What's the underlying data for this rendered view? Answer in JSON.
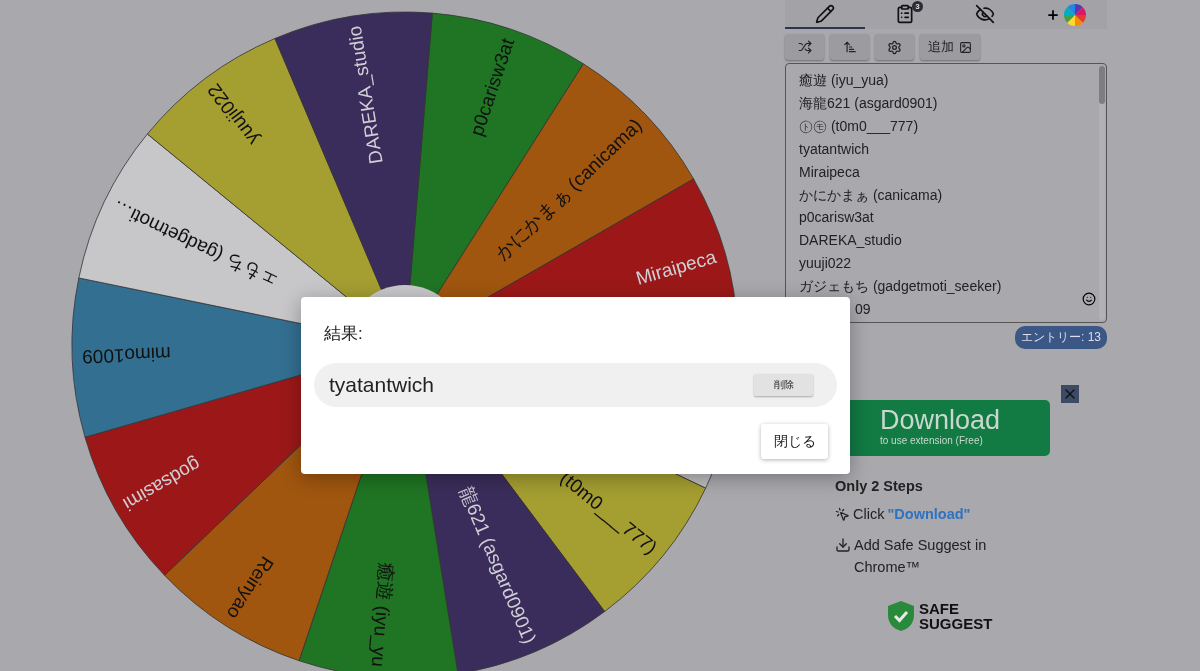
{
  "wheel": {
    "segments": [
      {
        "label": "p0carisw3at",
        "color": "#1f7523"
      },
      {
        "label": "かにかまぁ (canicama)",
        "color": "#a0560f"
      },
      {
        "label": "Miraipeca",
        "color": "#9c1818"
      },
      {
        "kind": "covered"
      },
      {
        "label": "(t0m0___777)",
        "color": "#a59e31"
      },
      {
        "label": "龍621 (asgard0901)",
        "color": "#3b2d5b"
      },
      {
        "label": "癒遊 (iyu_yu",
        "color": "#1f7523"
      },
      {
        "label": "Reinyao",
        "color": "#a0560f"
      },
      {
        "label": "godsasimi",
        "color": "#9c1818"
      },
      {
        "label": "mimo1009",
        "color": "#336f91"
      },
      {
        "label": "ェもち (gadgetmoti…",
        "color": "#c7c7c9"
      },
      {
        "label": "yuuji022",
        "color": "#a59e31"
      },
      {
        "label": "DAREKA_studio",
        "color": "#3b2d5b"
      }
    ]
  },
  "tabs": [
    {
      "selected": true
    },
    {
      "selected": false,
      "badge": "3"
    },
    {
      "selected": false
    }
  ],
  "toolbar": {
    "add_label": "追加"
  },
  "entries": {
    "items": [
      "癒遊 (iyu_yua)",
      "海龍621 (asgard0901)",
      "㋣㋲ (t0m0___777)",
      "tyatantwich",
      "Miraipeca",
      "かにかまぁ (canicama)",
      "p0carisw3at",
      "DAREKA_studio",
      "yuuji022",
      "ガジェもち (gadgetmoti_seeker)",
      "09"
    ],
    "count": "エントリー: 13"
  },
  "ad": {
    "button_title": "Download",
    "button_subtitle": "to use extension (Free)",
    "heading": "Only 2 Steps",
    "step_1_text": "Click",
    "step_1_link": "\"Download\"",
    "step_2": "Add Safe Suggest in Chrome™",
    "logo_line_1": "SAFE",
    "logo_line_2": "SUGGEST"
  },
  "dialog": {
    "title": "結果:",
    "result": "tyatantwich",
    "delete_label": "削除",
    "close_label": "閉じる"
  }
}
